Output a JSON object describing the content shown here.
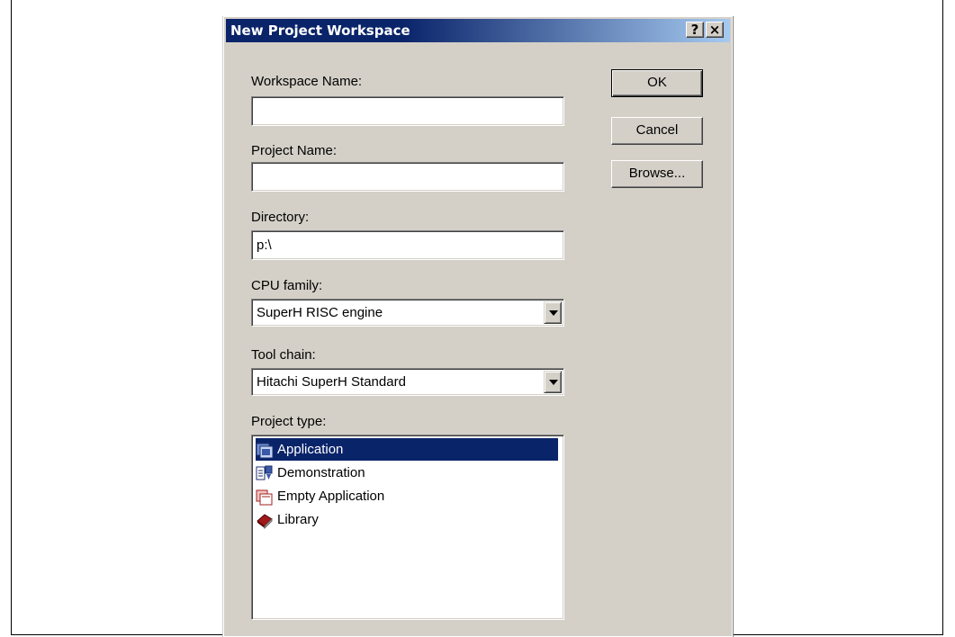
{
  "dialog": {
    "title": "New Project Workspace",
    "help_button": "?",
    "close_button": "×"
  },
  "fields": {
    "workspace_name": {
      "label": "Workspace Name:",
      "value": ""
    },
    "project_name": {
      "label": "Project Name:",
      "value": ""
    },
    "directory": {
      "label": "Directory:",
      "value": "p:\\"
    },
    "cpu_family": {
      "label": "CPU family:",
      "value": "SuperH RISC engine"
    },
    "tool_chain": {
      "label": "Tool chain:",
      "value": "Hitachi SuperH Standard"
    },
    "project_type": {
      "label": "Project type:",
      "items": [
        {
          "label": "Application",
          "icon": "application-icon",
          "selected": true
        },
        {
          "label": "Demonstration",
          "icon": "demonstration-icon",
          "selected": false
        },
        {
          "label": "Empty Application",
          "icon": "empty-application-icon",
          "selected": false
        },
        {
          "label": "Library",
          "icon": "library-icon",
          "selected": false
        }
      ]
    }
  },
  "buttons": {
    "ok": "OK",
    "cancel": "Cancel",
    "browse": "Browse..."
  },
  "colors": {
    "title_bar": "#0a246a",
    "dialog_face": "#d4d0c8",
    "selection": "#0a246a"
  }
}
